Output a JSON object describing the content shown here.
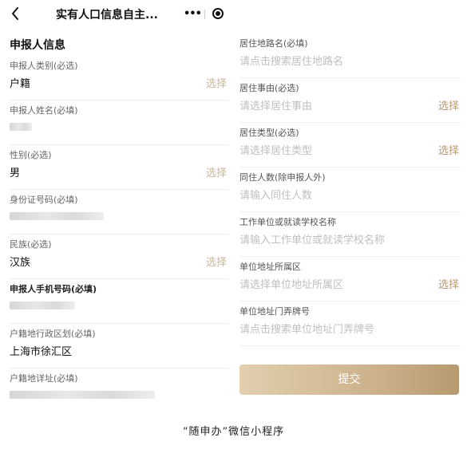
{
  "navbar": {
    "title": "实有人口信息自主...",
    "more_icon": "•••"
  },
  "left": {
    "section_title": "申报人信息",
    "fields": [
      {
        "label": "申报人类别(必选)",
        "value": "户籍",
        "action": "选择"
      },
      {
        "label": "申报人姓名(必填)",
        "value": "",
        "action": ""
      },
      {
        "label": "性别(必选)",
        "value": "男",
        "action": "选择"
      },
      {
        "label": "身份证号码(必填)",
        "value": "",
        "action": ""
      },
      {
        "label": "民族(必选)",
        "value": "汉族",
        "action": "选择"
      },
      {
        "label": "申报人手机号码(必填)",
        "value": "",
        "action": ""
      },
      {
        "label": "户籍地行政区划(必填)",
        "value": "上海市徐汇区",
        "action": ""
      },
      {
        "label": "户籍地详址(必填)",
        "value": "",
        "action": ""
      }
    ]
  },
  "right": {
    "fields": [
      {
        "label": "居住地路名(必填)",
        "placeholder": "请点击搜索居住地路名",
        "action": ""
      },
      {
        "label": "居住事由(必选)",
        "placeholder": "请选择居住事由",
        "action": "选择"
      },
      {
        "label": "居住类型(必选)",
        "placeholder": "请选择居住类型",
        "action": "选择"
      },
      {
        "label": "同住人数(除申报人外)",
        "placeholder": "请输入同住人数",
        "action": ""
      },
      {
        "label": "工作单位或就读学校名称",
        "placeholder": "请输入工作单位或就读学校名称",
        "action": ""
      },
      {
        "label": "单位地址所属区",
        "placeholder": "请选择单位地址所属区",
        "action": "选择"
      },
      {
        "label": "单位地址门弄牌号",
        "placeholder": "请点击搜索单位地址门弄牌号",
        "action": ""
      }
    ],
    "submit_label": "提交"
  },
  "caption": "“随申办”微信小程序",
  "colors": {
    "accent": "#c9b79a",
    "button_start": "#e1cfae",
    "button_end": "#b89a70"
  }
}
